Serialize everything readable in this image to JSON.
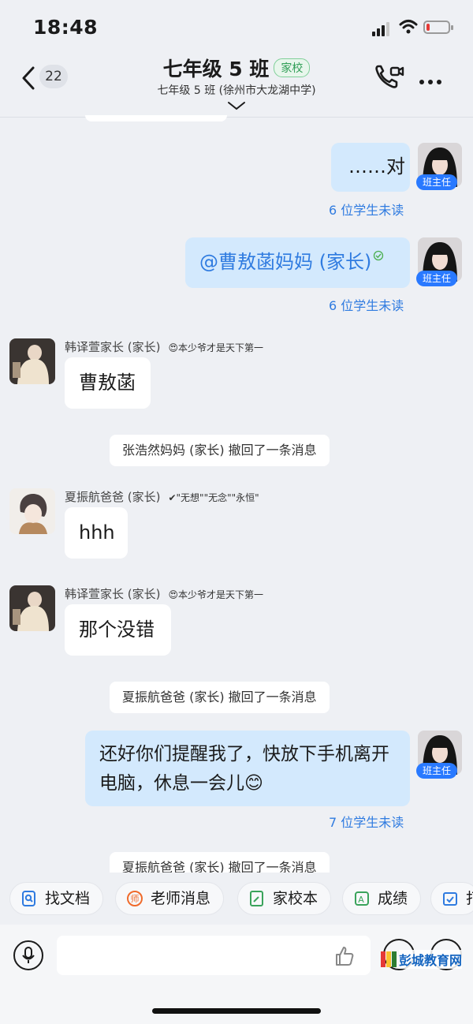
{
  "status_bar": {
    "time": "18:48",
    "battery_level": 0.15
  },
  "header": {
    "back_count": "22",
    "title": "七年级 5 班",
    "tag": "家校",
    "subtitle": "七年级 5 班 (徐州市大龙湖中学)"
  },
  "messages": {
    "m1": {
      "text": "……对",
      "role": "班主任",
      "read_status": "6 位学生未读"
    },
    "m2": {
      "text": "@曹敖菡妈妈 (家长)",
      "role": "班主任",
      "read_status": "6 位学生未读"
    },
    "m3": {
      "sender": "韩译萱家长 (家长)",
      "signature": "😍本少爷才是天下第一",
      "text": "曹敖菡"
    },
    "s1": {
      "text": "张浩然妈妈 (家长) 撤回了一条消息"
    },
    "m4": {
      "sender": "夏振航爸爸 (家长)",
      "signature": "✔\"无想\"\"无念\"\"永恒\"",
      "text": "hhh"
    },
    "m5": {
      "sender": "韩译萱家长 (家长)",
      "signature": "😍本少爷才是天下第一",
      "text": "那个没错"
    },
    "s2": {
      "text": "夏振航爸爸 (家长) 撤回了一条消息"
    },
    "m6": {
      "text": "还好你们提醒我了，快放下手机离开电脑，休息一会儿😊",
      "role": "班主任",
      "read_status": "7 位学生未读"
    },
    "s3": {
      "text": "夏振航爸爸 (家长) 撤回了一条消息"
    }
  },
  "quick_actions": [
    "找文档",
    "老师消息",
    "家校本",
    "成绩",
    "打"
  ],
  "watermark": "彭城教育网",
  "colors": {
    "accent": "#2f7be0",
    "outgoing_bubble": "#d3e9fd",
    "tag_green": "#2e9d55",
    "badge_blue": "#2979ff"
  }
}
